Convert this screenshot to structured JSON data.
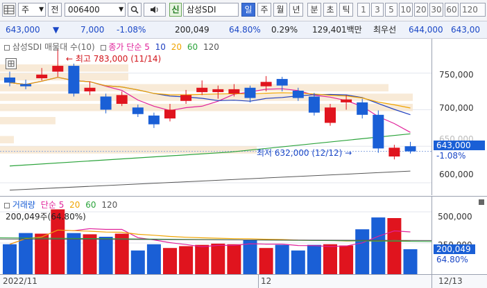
{
  "toolbar": {
    "type_box": "주",
    "kind_label": "전",
    "code": "006400",
    "badge": "신",
    "stock_name": "삼성SDI",
    "periods": [
      "일",
      "주",
      "월",
      "년",
      "분",
      "초",
      "틱"
    ],
    "numbers": [
      "1",
      "3",
      "5",
      "10",
      "20",
      "30",
      "60",
      "120"
    ]
  },
  "quote": {
    "price": "643,000",
    "direction": "▼",
    "change": "7,000",
    "change_pct": "-1.08%",
    "volume": "200,049",
    "volume_ratio": "64.80%",
    "turnover_pct": "0.29%",
    "amount": "129,401백만",
    "best_ask_label": "최우선",
    "best_ask": "644,000",
    "best_bid": "643,00"
  },
  "price_panel": {
    "legend_title": "삼성SDI 매물대 수(10)",
    "legend_ma_label": "종가 단순",
    "ma_periods": [
      "5",
      "10",
      "20",
      "60",
      "120"
    ],
    "ma_colors": [
      "#e0229a",
      "#1f3fbf",
      "#f0a400",
      "#2aa33a",
      "#555555"
    ],
    "high_annotation": "최고 783,000 (11/14)",
    "low_annotation": "최저 632,000 (12/12)",
    "y_ticks": [
      "750,000",
      "700,000",
      "650,000",
      "600,000"
    ],
    "current_price_tag": "643,000",
    "current_pct_tag": "-1.08%"
  },
  "volume_panel": {
    "legend_title": "거래량",
    "legend_ma_label": "단순",
    "ma_periods": [
      "5",
      "20",
      "60",
      "120"
    ],
    "ma_colors": [
      "#e0229a",
      "#f0a400",
      "#2aa33a",
      "#555555"
    ],
    "current_label": "200,049주(64.80%)",
    "y_ticks": [
      "500,000",
      "250,000"
    ],
    "current_volume_tag": "200,049",
    "current_pct_tag": "64.80%"
  },
  "x_axis": {
    "labels": [
      "2022/11",
      "12",
      "12/13"
    ]
  },
  "chart_data": {
    "type": "candlestick",
    "candles": [
      {
        "o": 744,
        "c": 737,
        "h": 752,
        "l": 732,
        "v": 240000
      },
      {
        "o": 735,
        "c": 732,
        "h": 741,
        "l": 728,
        "v": 330000
      },
      {
        "o": 743,
        "c": 748,
        "h": 757,
        "l": 740,
        "v": 325000
      },
      {
        "o": 752,
        "c": 760,
        "h": 783,
        "l": 745,
        "v": 520000
      },
      {
        "o": 760,
        "c": 722,
        "h": 763,
        "l": 718,
        "v": 330000
      },
      {
        "o": 725,
        "c": 730,
        "h": 738,
        "l": 720,
        "v": 320000
      },
      {
        "o": 718,
        "c": 700,
        "h": 722,
        "l": 695,
        "v": 300000
      },
      {
        "o": 708,
        "c": 720,
        "h": 725,
        "l": 705,
        "v": 325000
      },
      {
        "o": 703,
        "c": 694,
        "h": 707,
        "l": 690,
        "v": 190000
      },
      {
        "o": 692,
        "c": 680,
        "h": 696,
        "l": 675,
        "v": 240000
      },
      {
        "o": 688,
        "c": 700,
        "h": 708,
        "l": 684,
        "v": 210000
      },
      {
        "o": 712,
        "c": 720,
        "h": 727,
        "l": 708,
        "v": 225000
      },
      {
        "o": 724,
        "c": 730,
        "h": 740,
        "l": 720,
        "v": 235000
      },
      {
        "o": 724,
        "c": 728,
        "h": 733,
        "l": 715,
        "v": 245000
      },
      {
        "o": 722,
        "c": 728,
        "h": 735,
        "l": 718,
        "v": 240000
      },
      {
        "o": 730,
        "c": 716,
        "h": 733,
        "l": 710,
        "v": 275000
      },
      {
        "o": 732,
        "c": 738,
        "h": 746,
        "l": 725,
        "v": 210000
      },
      {
        "o": 742,
        "c": 733,
        "h": 745,
        "l": 725,
        "v": 235000
      },
      {
        "o": 726,
        "c": 716,
        "h": 730,
        "l": 712,
        "v": 190000
      },
      {
        "o": 718,
        "c": 696,
        "h": 723,
        "l": 692,
        "v": 235000
      },
      {
        "o": 682,
        "c": 703,
        "h": 708,
        "l": 678,
        "v": 240000
      },
      {
        "o": 710,
        "c": 714,
        "h": 720,
        "l": 700,
        "v": 230000
      },
      {
        "o": 710,
        "c": 693,
        "h": 715,
        "l": 688,
        "v": 360000
      },
      {
        "o": 693,
        "c": 647,
        "h": 699,
        "l": 641,
        "v": 455000
      },
      {
        "o": 636,
        "c": 648,
        "h": 652,
        "l": 632,
        "v": 450000
      },
      {
        "o": 650,
        "c": 643,
        "h": 656,
        "l": 640,
        "v": 200049
      }
    ],
    "up_color": "#e0141e",
    "down_color": "#1a5fd6",
    "ylim": [
      583,
      797
    ],
    "volume_ylim": [
      0,
      600000
    ]
  }
}
